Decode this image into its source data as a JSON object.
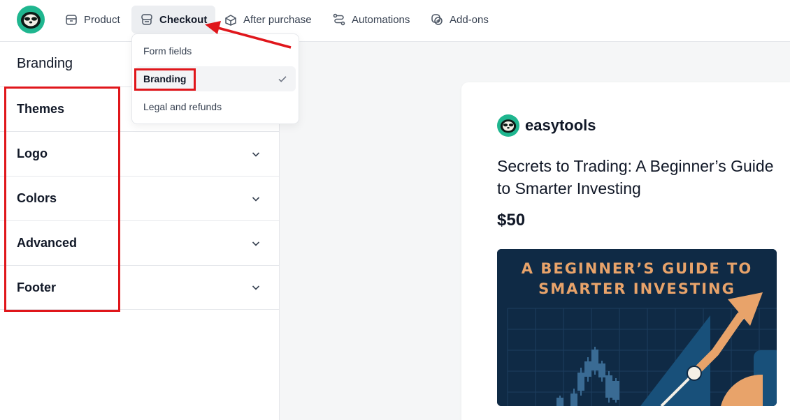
{
  "nav": {
    "items": [
      {
        "label": "Product",
        "icon": "box-icon"
      },
      {
        "label": "Checkout",
        "icon": "cart-icon",
        "active": true
      },
      {
        "label": "After purchase",
        "icon": "package-icon"
      },
      {
        "label": "Automations",
        "icon": "flow-icon"
      },
      {
        "label": "Add-ons",
        "icon": "add-circle-icon"
      }
    ]
  },
  "dropdown": {
    "items": [
      {
        "label": "Form fields"
      },
      {
        "label": "Branding",
        "selected": true
      },
      {
        "label": "Legal and refunds"
      }
    ]
  },
  "panel": {
    "title": "Branding",
    "sections": [
      "Themes",
      "Logo",
      "Colors",
      "Advanced",
      "Footer"
    ]
  },
  "preview": {
    "brand_name": "easytools",
    "product_title": "Secrets to Trading: A Beginner’s Guide to Smarter Investing",
    "price": "$50",
    "image_line1": "A BEGINNER’S GUIDE TO",
    "image_line2": "SMARTER INVESTING"
  },
  "colors": {
    "brand_green": "#1fb68f",
    "annotation_red": "#e0161b",
    "image_navy": "#0f2a45",
    "image_orange": "#e8a36a"
  }
}
